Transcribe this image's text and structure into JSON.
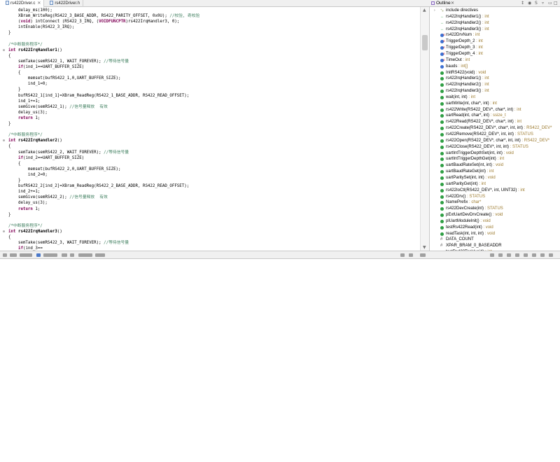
{
  "tabs": [
    {
      "label": "rs422Driver.c",
      "active": true
    },
    {
      "label": "rs422Driver.h",
      "active": false
    }
  ],
  "code_lines": [
    {
      "fold": "",
      "segs": [
        {
          "c": "",
          "t": "    delay_ms(100);"
        }
      ]
    },
    {
      "fold": "",
      "segs": [
        {
          "c": "",
          "t": "    XBram_WriteReg(RS422_3_BASE_ADDR, RS422_PARITY_OFFSET, 0x0U); "
        },
        {
          "c": "cm",
          "t": "//校验, 奇校验"
        }
      ]
    },
    {
      "fold": "",
      "segs": [
        {
          "c": "",
          "t": "    ("
        },
        {
          "c": "kw",
          "t": "void"
        },
        {
          "c": "",
          "t": ") intConnect (RS422_3_IRQ, ("
        },
        {
          "c": "hl-cast",
          "t": "VOIDFUNCPTR"
        },
        {
          "c": "",
          "t": ")rs422IrqHandler3, 0);"
        }
      ]
    },
    {
      "fold": "",
      "segs": [
        {
          "c": "",
          "t": "    intEnable(RS422_3_IRQ);"
        }
      ]
    },
    {
      "fold": "",
      "segs": [
        {
          "c": "",
          "t": "}"
        }
      ]
    },
    {
      "fold": "",
      "segs": [
        {
          "c": "",
          "t": ""
        }
      ]
    },
    {
      "fold": "",
      "segs": [
        {
          "c": "cm",
          "t": "/*中断服务程序*/"
        }
      ]
    },
    {
      "fold": "⊖",
      "segs": [
        {
          "c": "kw",
          "t": "int"
        },
        {
          "c": "",
          "t": " "
        },
        {
          "c": "fn",
          "t": "rs422IrqHandler1"
        },
        {
          "c": "",
          "t": "()"
        }
      ]
    },
    {
      "fold": "",
      "segs": [
        {
          "c": "",
          "t": "{"
        }
      ]
    },
    {
      "fold": "",
      "segs": [
        {
          "c": "",
          "t": "    semTake(semRS422_1, WAIT_FOREVER); "
        },
        {
          "c": "cm",
          "t": "//等待信号量"
        }
      ]
    },
    {
      "fold": "",
      "segs": [
        {
          "c": "",
          "t": "    "
        },
        {
          "c": "kw",
          "t": "if"
        },
        {
          "c": "",
          "t": "(ind_1==UART_BUFFER_SIZE)"
        }
      ]
    },
    {
      "fold": "",
      "segs": [
        {
          "c": "",
          "t": "    {"
        }
      ]
    },
    {
      "fold": "",
      "segs": [
        {
          "c": "",
          "t": "        memset(bufRS422_1,0,UART_BUFFER_SIZE);"
        }
      ]
    },
    {
      "fold": "",
      "segs": [
        {
          "c": "",
          "t": "        ind_1=0;"
        }
      ]
    },
    {
      "fold": "",
      "segs": [
        {
          "c": "",
          "t": "    }"
        }
      ]
    },
    {
      "fold": "",
      "segs": [
        {
          "c": "",
          "t": "    bufRS422_1[ind_1]=XBram_ReadReg(RS422_1_BASE_ADDR, RS422_READ_OFFSET);"
        }
      ]
    },
    {
      "fold": "",
      "segs": [
        {
          "c": "",
          "t": "    ind_1+=1;"
        }
      ]
    },
    {
      "fold": "",
      "segs": [
        {
          "c": "",
          "t": "    semGive(semRS422_1); "
        },
        {
          "c": "cm",
          "t": "//信号量释放  有效"
        }
      ]
    },
    {
      "fold": "",
      "segs": [
        {
          "c": "",
          "t": "    delay_us(3);"
        }
      ]
    },
    {
      "fold": "",
      "segs": [
        {
          "c": "",
          "t": "    "
        },
        {
          "c": "kw",
          "t": "return"
        },
        {
          "c": "",
          "t": " 1;"
        }
      ]
    },
    {
      "fold": "",
      "segs": [
        {
          "c": "",
          "t": "}"
        }
      ]
    },
    {
      "fold": "",
      "segs": [
        {
          "c": "",
          "t": ""
        }
      ]
    },
    {
      "fold": "",
      "segs": [
        {
          "c": "cm",
          "t": "/*中断服务程序*/"
        }
      ]
    },
    {
      "fold": "⊖",
      "segs": [
        {
          "c": "kw",
          "t": "int"
        },
        {
          "c": "",
          "t": " "
        },
        {
          "c": "fn",
          "t": "rs422IrqHandler2"
        },
        {
          "c": "",
          "t": "()"
        }
      ]
    },
    {
      "fold": "",
      "segs": [
        {
          "c": "",
          "t": "{"
        }
      ]
    },
    {
      "fold": "",
      "segs": [
        {
          "c": "",
          "t": "    semTake(semRS422_2, WAIT_FOREVER); "
        },
        {
          "c": "cm",
          "t": "//等待信号量"
        }
      ]
    },
    {
      "fold": "",
      "segs": [
        {
          "c": "",
          "t": "    "
        },
        {
          "c": "kw",
          "t": "if"
        },
        {
          "c": "",
          "t": "(ind_2==UART_BUFFER_SIZE)"
        }
      ]
    },
    {
      "fold": "",
      "segs": [
        {
          "c": "",
          "t": "    {"
        }
      ]
    },
    {
      "fold": "",
      "segs": [
        {
          "c": "",
          "t": "        memset(bufRS422_2,0,UART_BUFFER_SIZE);"
        }
      ]
    },
    {
      "fold": "",
      "segs": [
        {
          "c": "",
          "t": "        ind_2=0;"
        }
      ]
    },
    {
      "fold": "",
      "segs": [
        {
          "c": "",
          "t": "    }"
        }
      ]
    },
    {
      "fold": "",
      "segs": [
        {
          "c": "",
          "t": "    bufRS422_2[ind_2]=XBram_ReadReg(RS422_2_BASE_ADDR, RS422_READ_OFFSET);"
        }
      ]
    },
    {
      "fold": "",
      "segs": [
        {
          "c": "",
          "t": "    ind_2+=1;"
        }
      ]
    },
    {
      "fold": "",
      "segs": [
        {
          "c": "",
          "t": "    semGive(semRS422_2); "
        },
        {
          "c": "cm",
          "t": "//信号量释放  有效"
        }
      ]
    },
    {
      "fold": "",
      "segs": [
        {
          "c": "",
          "t": "    delay_us(3);"
        }
      ]
    },
    {
      "fold": "",
      "segs": [
        {
          "c": "",
          "t": "    "
        },
        {
          "c": "kw",
          "t": "return"
        },
        {
          "c": "",
          "t": " 1;"
        }
      ]
    },
    {
      "fold": "",
      "segs": [
        {
          "c": "",
          "t": "}"
        }
      ]
    },
    {
      "fold": "",
      "segs": [
        {
          "c": "",
          "t": ""
        }
      ]
    },
    {
      "fold": "",
      "segs": [
        {
          "c": "cm",
          "t": "/*中断服务程序*/"
        }
      ]
    },
    {
      "fold": "⊖",
      "segs": [
        {
          "c": "kw",
          "t": "int"
        },
        {
          "c": "",
          "t": " "
        },
        {
          "c": "fn",
          "t": "rs422IrqHandler3"
        },
        {
          "c": "",
          "t": "()"
        }
      ]
    },
    {
      "fold": "",
      "segs": [
        {
          "c": "",
          "t": "{"
        }
      ]
    },
    {
      "fold": "",
      "segs": [
        {
          "c": "",
          "t": "    semTake(semRS422_3, WAIT_FOREVER); "
        },
        {
          "c": "cm",
          "t": "//等待信号量"
        }
      ]
    },
    {
      "fold": "",
      "segs": [
        {
          "c": "",
          "t": "    "
        },
        {
          "c": "kw",
          "t": "if"
        },
        {
          "c": "",
          "t": "(ind_3=="
        }
      ]
    }
  ],
  "outline": {
    "title": "Outline",
    "items": [
      {
        "icon": "inc",
        "name": "include directives",
        "type": "",
        "arrow": "›"
      },
      {
        "icon": "green",
        "name": "rs422IrqHandler1()",
        "type": " : int",
        "prefix": "↔"
      },
      {
        "icon": "green",
        "name": "rs422IrqHandler2()",
        "type": " : int",
        "prefix": "↔"
      },
      {
        "icon": "green",
        "name": "rs422IrqHandler3()",
        "type": " : int",
        "prefix": "↔"
      },
      {
        "icon": "blue",
        "name": "rs422DrvNum",
        "type": " : int",
        "sup": "S"
      },
      {
        "icon": "blue",
        "name": "TriggerDepth_2",
        "type": " : int",
        "sup": "S"
      },
      {
        "icon": "blue",
        "name": "TriggerDepth_3",
        "type": " : int",
        "sup": "S"
      },
      {
        "icon": "blue",
        "name": "TriggerDepth_4",
        "type": " : int",
        "sup": "S"
      },
      {
        "icon": "blue",
        "name": "TimeOut",
        "type": " : int",
        "sup": "S"
      },
      {
        "icon": "blue",
        "name": "bauds",
        "type": " : int[]"
      },
      {
        "icon": "green",
        "name": "InitRS422(void)",
        "type": " : void"
      },
      {
        "icon": "green",
        "name": "rs422IrqHandler1()",
        "type": " : int"
      },
      {
        "icon": "green",
        "name": "rs422IrqHandler2()",
        "type": " : int"
      },
      {
        "icon": "green",
        "name": "rs422IrqHandler3()",
        "type": " : int"
      },
      {
        "icon": "green",
        "name": "wait(int, int)",
        "type": " : int"
      },
      {
        "icon": "green",
        "name": "uartWrite(int, char*, int)",
        "type": " : int"
      },
      {
        "icon": "green",
        "name": "rs422Write(RS422_DEV*, char*, int)",
        "type": " : int"
      },
      {
        "icon": "green",
        "name": "uartRead(int, char*, int)",
        "type": " : ssize_t"
      },
      {
        "icon": "green",
        "name": "rs422Read(RS422_DEV*, char*, int)",
        "type": " : int"
      },
      {
        "icon": "green",
        "name": "rs422Create(RS422_DEV*, char*, int, int)",
        "type": " : RS422_DEV*"
      },
      {
        "icon": "green",
        "name": "rs422Remove(RS422_DEV*, int, int)",
        "type": " : STATUS"
      },
      {
        "icon": "green",
        "name": "rs422Open(RS422_DEV*, char*, int, int)",
        "type": " : RS422_DEV*"
      },
      {
        "icon": "green",
        "name": "rs422Close(RS422_DEV*, int, int)",
        "type": " : STATUS"
      },
      {
        "icon": "green",
        "name": "uartIntTriggerDepthSet(int, int)",
        "type": " : void"
      },
      {
        "icon": "green",
        "name": "uartIntTriggerDepthGet(int)",
        "type": " : int"
      },
      {
        "icon": "green",
        "name": "uartBaudRateSet(int, int)",
        "type": " : void"
      },
      {
        "icon": "green",
        "name": "uartBaudRateGet(int)",
        "type": " : int"
      },
      {
        "icon": "green",
        "name": "uartParitySet(int, int)",
        "type": " : void"
      },
      {
        "icon": "green",
        "name": "uartParityGet(int)",
        "type": " : int"
      },
      {
        "icon": "green",
        "name": "rs422IoCtl(RS422_DEV*, int, UINT32)",
        "type": " : int"
      },
      {
        "icon": "green",
        "name": "rs422Drv()",
        "type": " : STATUS"
      },
      {
        "icon": "green",
        "name": "NamePrefix",
        "type": " : char*"
      },
      {
        "icon": "green",
        "name": "rs422DevCreate(int)",
        "type": " : STATUS"
      },
      {
        "icon": "green",
        "name": "pExtUartDevDrvCreate()",
        "type": " : void"
      },
      {
        "icon": "green",
        "name": "plUartModuleInit()",
        "type": " : void"
      },
      {
        "icon": "green",
        "name": "testRs422Read(int)",
        "type": " : void"
      },
      {
        "icon": "green",
        "name": "readTask(int, int, int)",
        "type": " : void"
      },
      {
        "icon": "hash",
        "name": "DATA_COUNT",
        "type": ""
      },
      {
        "icon": "hash",
        "name": "XPAR_BRAM_0_BASEADDR",
        "type": ""
      },
      {
        "icon": "green",
        "name": "testRs422Task(void)",
        "type": " : int"
      }
    ]
  },
  "colors": {
    "keyword": "#7f0055",
    "comment": "#3f7f5f",
    "type_suffix": "#9c7a2e",
    "method_icon": "#2f9e44",
    "field_icon": "#3c6fd1"
  }
}
